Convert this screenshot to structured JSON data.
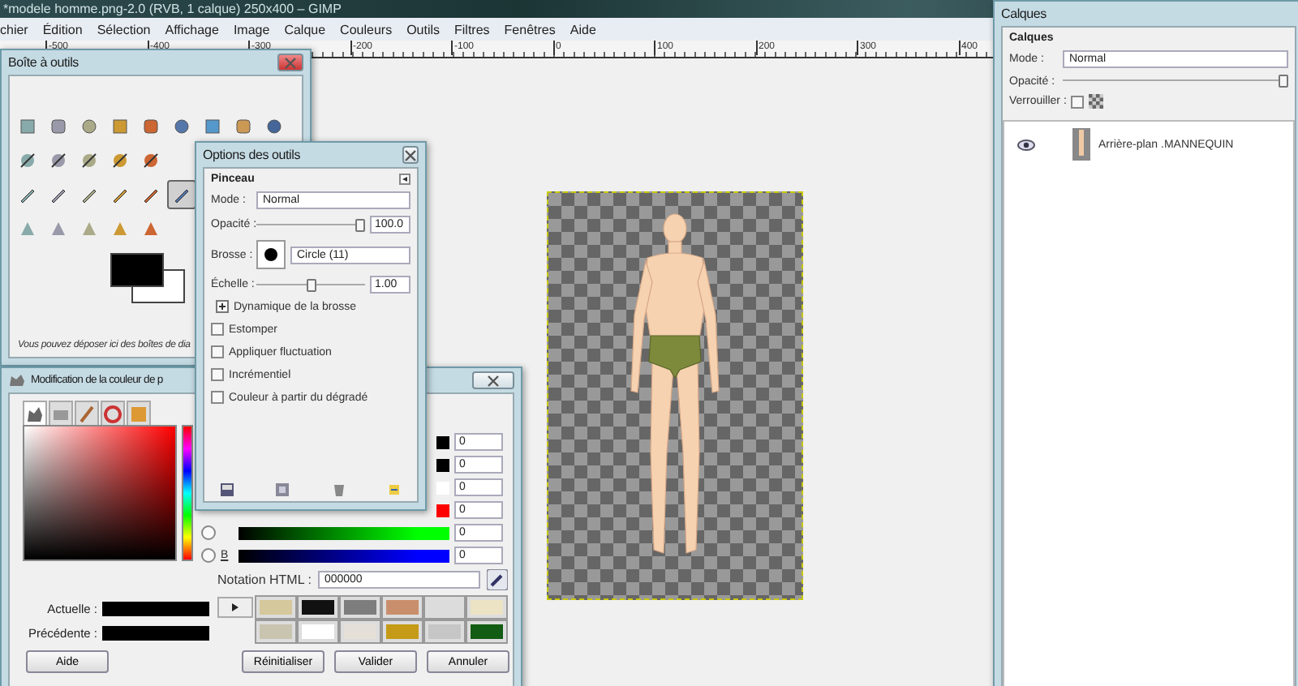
{
  "main_window": {
    "title": "*modele homme.png-2.0 (RVB, 1 calque) 250x400 – GIMP",
    "menu": [
      "chier",
      "Édition",
      "Sélection",
      "Affichage",
      "Image",
      "Calque",
      "Couleurs",
      "Outils",
      "Filtres",
      "Fenêtres",
      "Aide"
    ],
    "ruler_labels": [
      "-500",
      "-400",
      "-300",
      "-200",
      "-100",
      "0",
      "100",
      "200",
      "300",
      "400"
    ]
  },
  "toolbox": {
    "title": "Boîte à outils",
    "tool_rows": [
      [
        {
          "selected": false
        },
        {
          "selected": false
        },
        {
          "selected": false
        },
        {
          "selected": false
        },
        {
          "selected": false
        },
        {
          "selected": false
        },
        {
          "selected": false
        },
        {
          "selected": false
        },
        {
          "selected": false
        }
      ],
      [
        {
          "selected": false
        },
        {
          "selected": false
        },
        {
          "selected": false
        },
        {
          "selected": false
        },
        {
          "selected": false
        }
      ],
      [
        {
          "selected": false
        },
        {
          "selected": false
        },
        {
          "selected": false
        },
        {
          "selected": false
        },
        {
          "selected": false
        },
        {
          "selected": true
        }
      ],
      [
        {
          "selected": false
        },
        {
          "selected": false
        },
        {
          "selected": false
        },
        {
          "selected": false
        },
        {
          "selected": false
        }
      ]
    ],
    "hint": "Vous pouvez déposer ici des boîtes de dia"
  },
  "tool_options": {
    "title": "Options des outils",
    "tool": "Pinceau",
    "mode_label": "Mode :",
    "mode": "Normal",
    "opacity_label": "Opacité :",
    "opacity": {
      "level": 1,
      "reading": "100.0"
    },
    "brush_label": "Brosse :",
    "brush": "Circle (11)",
    "scale_label": "Échelle :",
    "scale": {
      "level": 0.5,
      "reading": "1.00"
    },
    "expander": {
      "label": "Dynamique de la brosse",
      "expanded": false
    },
    "options": [
      {
        "label": "Estomper",
        "checked": false
      },
      {
        "label": "Appliquer fluctuation",
        "checked": false
      },
      {
        "label": "Incrémentiel",
        "checked": false
      },
      {
        "label": "Couleur à partir du dégradé",
        "checked": false
      }
    ]
  },
  "color_dialog": {
    "title": "Modification de la couleur de p",
    "tabs": [
      {
        "selected": true
      },
      {
        "selected": false
      },
      {
        "selected": false
      },
      {
        "selected": false
      },
      {
        "selected": false
      }
    ],
    "channels": [
      {
        "value": "0",
        "color": "#000000"
      },
      {
        "value": "0",
        "color": "#000000"
      },
      {
        "value": "0",
        "color": "#ffffff"
      },
      {
        "value": "0",
        "color": "#ff0000"
      },
      {
        "value": "0",
        "color": "#00ff00",
        "selected": false
      },
      {
        "label": "B",
        "value": "0",
        "color": "#0000ff",
        "selected": false
      }
    ],
    "html_label": "Notation HTML :",
    "html_value": "000000",
    "current_label": "Actuelle :",
    "previous_label": "Précédente :",
    "swatches": [
      {
        "color": "#d4c89c"
      },
      {
        "color": "#111111"
      },
      {
        "color": "#7d7d7d"
      },
      {
        "color": "#c98f6d"
      },
      {
        "color": "#dcdcdc"
      },
      {
        "color": "#ece3c4"
      },
      {
        "color": "#c9c4b0"
      },
      {
        "color": "#ffffff"
      },
      {
        "color": "#e4e0d8"
      },
      {
        "color": "#c49a17"
      },
      {
        "color": "#c6c6c6"
      },
      {
        "color": "#135c13"
      }
    ],
    "buttons": [
      "Aide",
      "Réinitialiser",
      "Valider",
      "Annuler"
    ]
  },
  "layers": {
    "title": "Calques",
    "heading": "Calques",
    "mode_label": "Mode :",
    "mode": "Normal",
    "opacity_label": "Opacité :",
    "opacity": {
      "level": 1
    },
    "lock_label": "Verrouiller :",
    "lock_pixels": {
      "checked": false
    },
    "items": [
      {
        "name": "Arrière-plan .MANNEQUIN",
        "visible": true
      }
    ]
  }
}
